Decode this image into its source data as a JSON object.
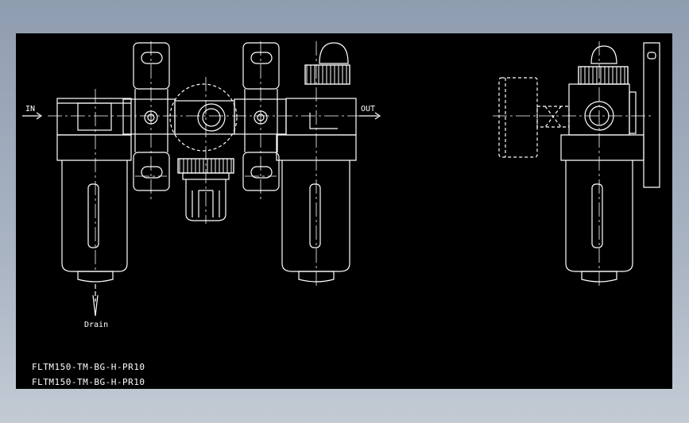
{
  "labels": {
    "inlet": "IN",
    "outlet": "OUT",
    "drain": "Drain"
  },
  "part_numbers": [
    "FLTM150-TM-BG-H-PR10",
    "FLTM150-TM-BG-H-PR10"
  ],
  "colors": {
    "background": "#000000",
    "line": "#ffffff",
    "frame_gradient_top": "#8f9db0"
  }
}
